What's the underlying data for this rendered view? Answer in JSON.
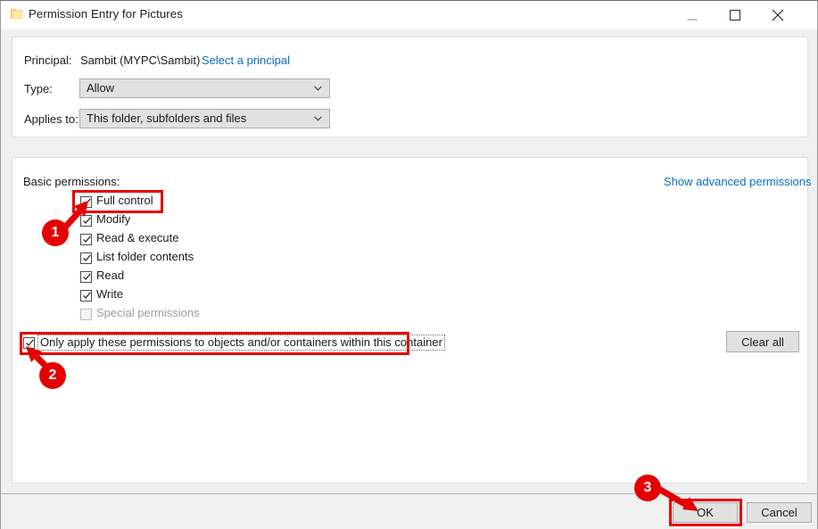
{
  "window": {
    "title": "Permission Entry for Pictures",
    "icon": "folder-icon",
    "controls": {
      "minimize": "minimize-icon",
      "maximize": "maximize-icon",
      "close": "close-icon"
    }
  },
  "principal": {
    "label": "Principal:",
    "value": "Sambit (MYPC\\Sambit)",
    "select_link": "Select a principal"
  },
  "type": {
    "label": "Type:",
    "value": "Allow"
  },
  "applies_to": {
    "label": "Applies to:",
    "value": "This folder, subfolders and files"
  },
  "permissions": {
    "section_label": "Basic permissions:",
    "advanced_link": "Show advanced permissions",
    "items": [
      {
        "label": "Full control",
        "checked": true,
        "disabled": false
      },
      {
        "label": "Modify",
        "checked": true,
        "disabled": false
      },
      {
        "label": "Read & execute",
        "checked": true,
        "disabled": false
      },
      {
        "label": "List folder contents",
        "checked": true,
        "disabled": false
      },
      {
        "label": "Read",
        "checked": true,
        "disabled": false
      },
      {
        "label": "Write",
        "checked": true,
        "disabled": false
      },
      {
        "label": "Special permissions",
        "checked": false,
        "disabled": true
      }
    ]
  },
  "only_apply": {
    "label": "Only apply these permissions to objects and/or containers within this container",
    "checked": true
  },
  "buttons": {
    "clear_all": "Clear all",
    "ok": "OK",
    "cancel": "Cancel"
  },
  "annotations": {
    "badges": [
      {
        "number": "1",
        "target": "full-control-checkbox"
      },
      {
        "number": "2",
        "target": "only-apply-checkbox"
      },
      {
        "number": "3",
        "target": "ok-button"
      }
    ],
    "highlight_color": "#e50000"
  },
  "colors": {
    "link": "#0b6ec4",
    "dialog_background": "#f0f0f0",
    "panel_background": "#ffffff",
    "control_background": "#e1e1e1",
    "annotation": "#e50000"
  }
}
